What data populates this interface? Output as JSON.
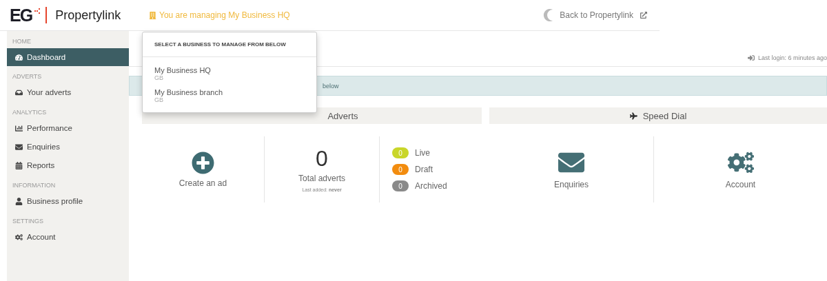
{
  "header": {
    "logo_mark": "EG",
    "brand": "Propertylink",
    "managing": "You are managing My Business HQ",
    "back_link": "Back to Propertylink"
  },
  "sidebar": [
    {
      "heading": "HOME",
      "items": [
        {
          "label": "Dashboard",
          "selected": true
        }
      ]
    },
    {
      "heading": "ADVERTS",
      "items": [
        {
          "label": "Your adverts",
          "selected": false
        }
      ]
    },
    {
      "heading": "ANALYTICS",
      "items": [
        {
          "label": "Performance",
          "selected": false
        },
        {
          "label": "Enquiries",
          "selected": false
        },
        {
          "label": "Reports",
          "selected": false
        }
      ]
    },
    {
      "heading": "INFORMATION",
      "items": [
        {
          "label": "Business profile",
          "selected": false
        }
      ]
    },
    {
      "heading": "SETTINGS",
      "items": [
        {
          "label": "Account",
          "selected": false
        }
      ]
    }
  ],
  "last_login": "Last login: 6 minutes ago",
  "alert": "below",
  "adverts": {
    "title": "Adverts",
    "create": "Create an ad",
    "total": "0",
    "total_label": "Total adverts",
    "last_added": "Last added: **never**",
    "statuses": [
      {
        "count": "0",
        "label": "Live",
        "color": "#c9d62a"
      },
      {
        "count": "0",
        "label": "Draft",
        "color": "#f28c0f"
      },
      {
        "count": "0",
        "label": "Archived",
        "color": "#8a8a8a"
      }
    ]
  },
  "speed_dial": {
    "title": "Speed Dial",
    "items": [
      {
        "label": "Enquiries"
      },
      {
        "label": "Account"
      }
    ]
  },
  "dropdown": {
    "heading": "SELECT A BUSINESS TO MANAGE FROM BELOW",
    "businesses": [
      {
        "name": "My Business HQ",
        "country": "GB"
      },
      {
        "name": "My Business branch",
        "country": "GB"
      }
    ]
  }
}
